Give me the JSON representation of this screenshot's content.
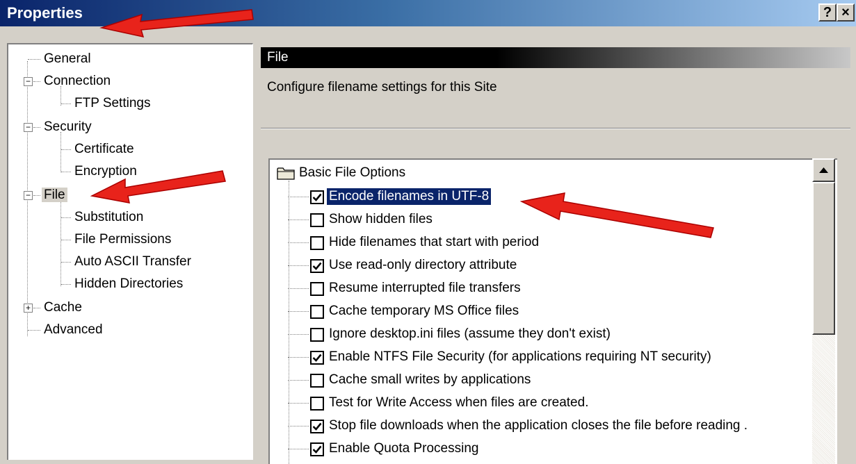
{
  "window": {
    "title": "Properties",
    "help_button": "?",
    "close_button": "×"
  },
  "tree": [
    {
      "label": "General"
    },
    {
      "label": "Connection"
    },
    {
      "label": "FTP Settings"
    },
    {
      "label": "Security"
    },
    {
      "label": "Certificate"
    },
    {
      "label": "Encryption"
    },
    {
      "label": "File"
    },
    {
      "label": "Substitution"
    },
    {
      "label": "File Permissions"
    },
    {
      "label": "Auto ASCII Transfer"
    },
    {
      "label": "Hidden Directories"
    },
    {
      "label": "Cache"
    },
    {
      "label": "Advanced"
    }
  ],
  "tree_toggles": {
    "connection": "−",
    "security": "−",
    "file": "−",
    "cache": "+"
  },
  "panel": {
    "header": "File",
    "description": "Configure filename settings for this Site"
  },
  "options": {
    "group_label": "Basic File Options",
    "items": [
      {
        "label": "Encode filenames in UTF-8",
        "checked": true
      },
      {
        "label": "Show hidden files",
        "checked": false
      },
      {
        "label": "Hide filenames that start with period",
        "checked": false
      },
      {
        "label": "Use read-only directory attribute",
        "checked": true
      },
      {
        "label": "Resume interrupted file transfers",
        "checked": false
      },
      {
        "label": "Cache temporary MS Office files",
        "checked": false
      },
      {
        "label": "Ignore desktop.ini files (assume they don't exist)",
        "checked": false
      },
      {
        "label": "Enable NTFS File Security (for applications requiring NT security)",
        "checked": true
      },
      {
        "label": "Cache small writes by applications",
        "checked": false
      },
      {
        "label": "Test for Write Access when files are created.",
        "checked": false
      },
      {
        "label": "Stop file downloads when the application closes the file before reading .",
        "checked": true
      },
      {
        "label": "Enable Quota Processing",
        "checked": true
      }
    ]
  },
  "colors": {
    "titlebar_start": "#0a246a",
    "titlebar_end": "#a6caf0",
    "face": "#d4d0c8",
    "selection": "#0a246a",
    "annotation_arrow": "#e8231b"
  }
}
